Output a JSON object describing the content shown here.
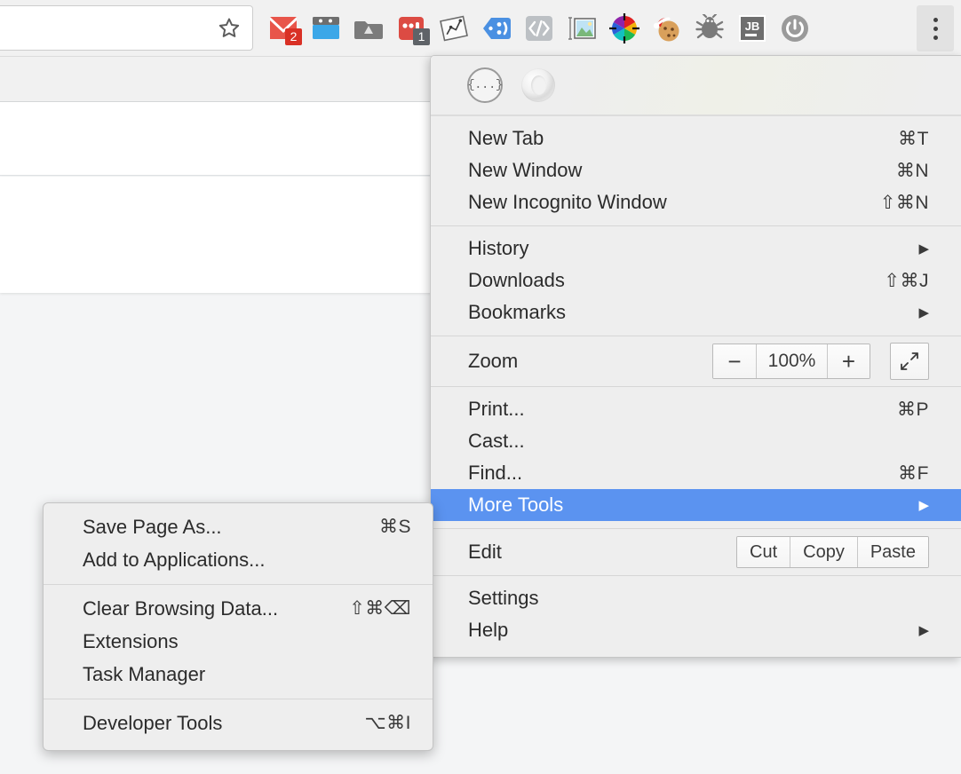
{
  "browser": {
    "omnibox": {
      "value": "",
      "placeholder": "",
      "star_icon": "bookmark-star-icon"
    },
    "extensions": [
      {
        "name": "gmail-extension",
        "icon": "gmail-envelope-icon",
        "badge": "2",
        "badge_color": "#d93025"
      },
      {
        "name": "window-extension",
        "icon": "blue-window-icon",
        "badge": "",
        "badge_color": ""
      },
      {
        "name": "google-drive-extension",
        "icon": "drive-folder-icon",
        "badge": "",
        "badge_color": ""
      },
      {
        "name": "red-dots-extension",
        "icon": "red-dots-icon",
        "badge": "1",
        "badge_color": "#5f6368"
      },
      {
        "name": "chart-note-extension",
        "icon": "chart-note-icon",
        "badge": "",
        "badge_color": ""
      },
      {
        "name": "tag-smiley-extension",
        "icon": "blue-tag-smiley-icon",
        "badge": "",
        "badge_color": ""
      },
      {
        "name": "code-extension",
        "icon": "angle-brackets-slash-icon",
        "badge": "",
        "badge_color": ""
      },
      {
        "name": "image-extension",
        "icon": "picture-frame-icon",
        "badge": "",
        "badge_color": ""
      },
      {
        "name": "color-picker-extension",
        "icon": "color-wheel-crosshair-icon",
        "badge": "",
        "badge_color": ""
      },
      {
        "name": "cookie-extension",
        "icon": "santa-cookie-icon",
        "badge": "",
        "badge_color": ""
      },
      {
        "name": "bug-extension",
        "icon": "gray-bug-icon",
        "badge": "",
        "badge_color": ""
      },
      {
        "name": "jetbrains-extension",
        "icon": "jb-toolbox-icon",
        "badge": "",
        "badge_color": ""
      },
      {
        "name": "power-extension",
        "icon": "power-button-icon",
        "badge": "",
        "badge_color": ""
      }
    ],
    "menu_button": {
      "name": "chrome-menu-button",
      "icon": "three-dots-vertical-icon"
    }
  },
  "chrome_menu": {
    "top_icons": [
      {
        "name": "json-viewer-icon",
        "glyph": "{...}"
      },
      {
        "name": "grayscale-ring-icon",
        "glyph": ""
      }
    ],
    "group1": [
      {
        "label": "New Tab",
        "accel": "⌘T",
        "arrow": ""
      },
      {
        "label": "New Window",
        "accel": "⌘N",
        "arrow": ""
      },
      {
        "label": "New Incognito Window",
        "accel": "⇧⌘N",
        "arrow": ""
      }
    ],
    "group2": [
      {
        "label": "History",
        "accel": "",
        "arrow": "▶"
      },
      {
        "label": "Downloads",
        "accel": "⇧⌘J",
        "arrow": ""
      },
      {
        "label": "Bookmarks",
        "accel": "",
        "arrow": "▶"
      }
    ],
    "zoom_row": {
      "label": "Zoom",
      "minus_label": "−",
      "level": "100%",
      "plus_label": "+",
      "fullscreen_icon": "fullscreen-expand-icon"
    },
    "group3": [
      {
        "label": "Print...",
        "accel": "⌘P",
        "arrow": "",
        "selected": false
      },
      {
        "label": "Cast...",
        "accel": "",
        "arrow": "",
        "selected": false
      },
      {
        "label": "Find...",
        "accel": "⌘F",
        "arrow": "",
        "selected": false
      },
      {
        "label": "More Tools",
        "accel": "",
        "arrow": "▶",
        "selected": true
      }
    ],
    "edit_row": {
      "label": "Edit",
      "cut_label": "Cut",
      "copy_label": "Copy",
      "paste_label": "Paste"
    },
    "group4": [
      {
        "label": "Settings",
        "accel": "",
        "arrow": ""
      },
      {
        "label": "Help",
        "accel": "",
        "arrow": "▶"
      }
    ],
    "highlight_color": "#5b93f0",
    "background_color": "#eeeeee"
  },
  "more_tools_submenu": {
    "group1": [
      {
        "label": "Save Page As...",
        "accel": "⌘S"
      },
      {
        "label": "Add to Applications...",
        "accel": ""
      }
    ],
    "group2": [
      {
        "label": "Clear Browsing Data...",
        "accel": "⇧⌘⌫"
      },
      {
        "label": "Extensions",
        "accel": ""
      },
      {
        "label": "Task Manager",
        "accel": ""
      }
    ],
    "group3": [
      {
        "label": "Developer Tools",
        "accel": "⌥⌘I"
      }
    ]
  }
}
